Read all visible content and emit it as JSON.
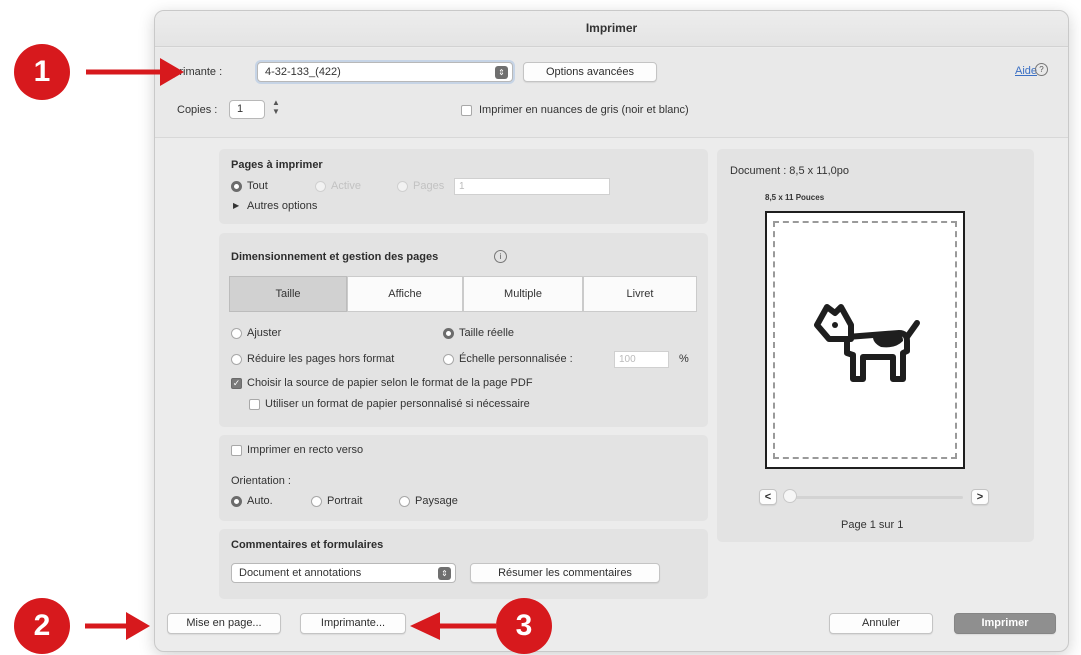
{
  "dialog": {
    "title": "Imprimer",
    "printer_label": "Imprimante :",
    "printer_value": "4-32-133_(422)",
    "advanced_options_button": "Options avancées",
    "help_link": "Aide",
    "copies_label": "Copies :",
    "copies_value": "1",
    "grayscale_label": "Imprimer en nuances de gris (noir et blanc)"
  },
  "pages_section": {
    "heading": "Pages à imprimer",
    "all_label": "Tout",
    "current_label": "Active",
    "pages_label": "Pages",
    "pages_value": "1",
    "more_options_label": "Autres options"
  },
  "sizing_section": {
    "heading": "Dimensionnement et gestion des pages",
    "tabs": [
      "Taille",
      "Affiche",
      "Multiple",
      "Livret"
    ],
    "fit_label": "Ajuster",
    "actual_size_label": "Taille réelle",
    "shrink_label": "Réduire les pages hors format",
    "custom_scale_label": "Échelle personnalisée :",
    "custom_scale_value": "100",
    "percent_sign": "%",
    "paper_source_label": "Choisir la source de papier selon le format de la page PDF",
    "custom_paper_label": "Utiliser un format de papier personnalisé si nécessaire"
  },
  "duplex_section": {
    "duplex_label": "Imprimer en recto verso",
    "orientation_label": "Orientation :",
    "auto_label": "Auto.",
    "portrait_label": "Portrait",
    "landscape_label": "Paysage"
  },
  "comments_section": {
    "heading": "Commentaires et formulaires",
    "select_value": "Document et annotations",
    "summarize_button": "Résumer les commentaires"
  },
  "preview": {
    "document_size": "Document : 8,5 x 11,0po",
    "paper_label": "8,5 x 11 Pouces",
    "prev_button": "<",
    "next_button": ">",
    "page_status": "Page 1 sur 1"
  },
  "footer": {
    "page_setup_button": "Mise en page...",
    "printer_button": "Imprimante...",
    "cancel_button": "Annuler",
    "print_button": "Imprimer"
  },
  "callouts": [
    "1",
    "2",
    "3"
  ],
  "colors": {
    "callout_red": "#d7191d",
    "print_button_bg": "#8f8f8f",
    "help_link": "#3a6fc4",
    "dog_outline": "#1e1e1e"
  },
  "icons": {
    "select_arrow": "up-down-chevron-icon",
    "help": "help-circle-icon",
    "info": "info-icon",
    "preview_image": "dogcow-icon"
  }
}
